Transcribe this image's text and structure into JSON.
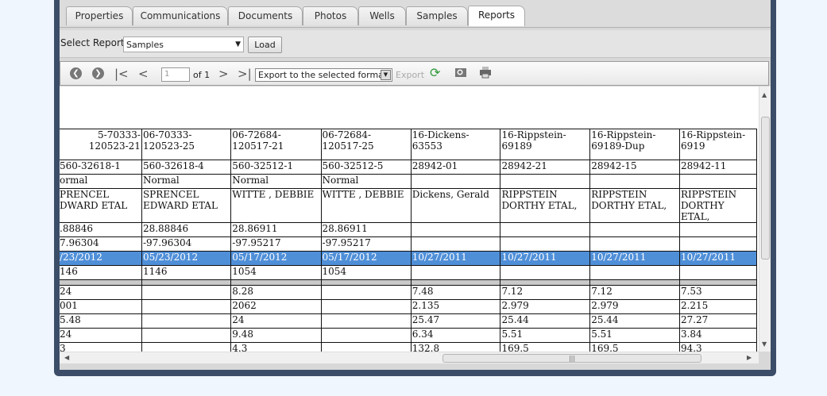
{
  "tabs": [
    "Properties",
    "Communications",
    "Documents",
    "Photos",
    "Wells",
    "Samples",
    "Reports"
  ],
  "active_tab": "Reports",
  "report_select": {
    "label": "Select Report :",
    "value": "Samples",
    "load_label": "Load"
  },
  "viewer": {
    "page_value": "1",
    "page_of": "of 1",
    "format_value": "Export to the selected format",
    "export_label": "Export"
  },
  "table": {
    "columns": [
      [
        "5-70333-120523-21",
        "560-32618-1",
        "ormal",
        "PRENCEL DWARD ETAL",
        ".88846",
        "7.96304",
        "/23/2012",
        "146",
        "",
        "24",
        "001",
        "5.48",
        "24",
        "3"
      ],
      [
        "06-70333-120523-25",
        "560-32618-4",
        "Normal",
        "SPRENCEL EDWARD ETAL",
        "28.88846",
        "-97.96304",
        "05/23/2012",
        "1146",
        "",
        "",
        "",
        "",
        "",
        ""
      ],
      [
        "06-72684-120517-21",
        "560-32512-1",
        "Normal",
        "WITTE , DEBBIE",
        "28.86911",
        "-97.95217",
        "05/17/2012",
        "1054",
        "",
        "8.28",
        "2062",
        "24",
        "9.48",
        "4.3"
      ],
      [
        "06-72684-120517-25",
        "560-32512-5",
        "Normal",
        "WITTE , DEBBIE",
        "28.86911",
        "-97.95217",
        "05/17/2012",
        "1054",
        "",
        "",
        "",
        "",
        "",
        ""
      ],
      [
        "16-Dickens-63553",
        "28942-01",
        "",
        "Dickens, Gerald",
        "",
        "",
        "10/27/2011",
        "",
        "",
        "7.48",
        "2.135",
        "25.47",
        "6.34",
        "132.8"
      ],
      [
        "16-Rippstein-69189",
        "28942-21",
        "",
        "RIPPSTEIN DORTHY ETAL,",
        "",
        "",
        "10/27/2011",
        "",
        "",
        "7.12",
        "2.979",
        "25.44",
        "5.51",
        "169.5"
      ],
      [
        "16-Rippstein-69189-Dup",
        "28942-15",
        "",
        "RIPPSTEIN DORTHY ETAL,",
        "",
        "",
        "10/27/2011",
        "",
        "",
        "7.12",
        "2.979",
        "25.44",
        "5.51",
        "169.5"
      ],
      [
        "16-Rippstein-6919",
        "28942-11",
        "",
        "RIPPSTEIN DORTHY ETAL,",
        "",
        "",
        "10/27/2011",
        "",
        "",
        "7.53",
        "2.215",
        "27.27",
        "3.84",
        "94.3"
      ]
    ]
  },
  "colors": {
    "frame": "#3b4d68",
    "selection": "#4f8fd8",
    "background": "#f0f6fd"
  },
  "icons": [
    "first-circle-icon",
    "next-circle-icon",
    "first-page-icon",
    "prev-page-icon",
    "next-page-icon",
    "last-page-icon",
    "refresh-icon",
    "zoom-icon",
    "print-icon"
  ]
}
